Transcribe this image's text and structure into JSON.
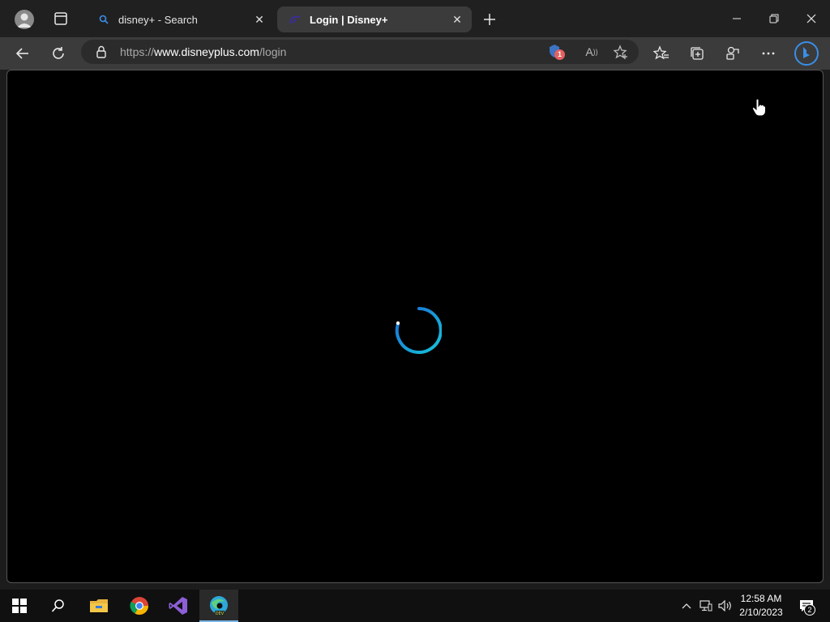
{
  "browser": {
    "tabs": [
      {
        "title": "disney+ - Search",
        "active": false,
        "favicon": "search-icon"
      },
      {
        "title": "Login | Disney+",
        "active": true,
        "favicon": "disney-plus-logo"
      }
    ],
    "address": {
      "scheme": "https://",
      "host": "www.disneyplus.com",
      "path": "/login"
    },
    "tracking_badge": "1"
  },
  "page": {
    "state": "loading",
    "spinner_colors": [
      "#1a6bd8",
      "#17c3d9"
    ]
  },
  "taskbar": {
    "clock_time": "12:58 AM",
    "clock_date": "2/10/2023",
    "notification_count": "2",
    "apps": [
      "start-icon",
      "search-icon",
      "file-explorer-icon",
      "chrome-icon",
      "visual-studio-icon",
      "edge-dev-icon"
    ]
  }
}
